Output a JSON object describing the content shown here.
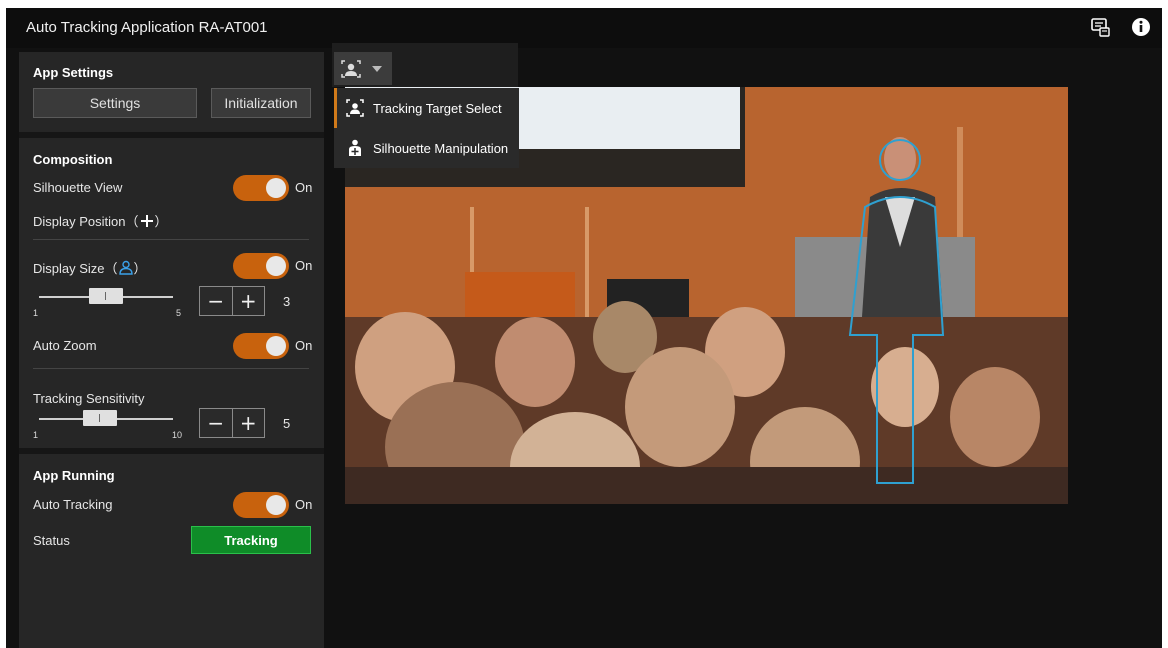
{
  "app": {
    "title": "Auto Tracking Application RA-AT001"
  },
  "header_icons": {
    "feedback": "feedback-icon",
    "info": "info-icon"
  },
  "app_settings": {
    "title": "App Settings",
    "settings_label": "Settings",
    "initialization_label": "Initialization"
  },
  "composition": {
    "title": "Composition",
    "silhouette_view": {
      "label": "Silhouette View",
      "state": "On"
    },
    "display_position": {
      "label": "Display Position（",
      "suffix": "）"
    },
    "display_size": {
      "label": "Display Size（",
      "suffix": "）",
      "state": "On",
      "min": "1",
      "max": "5",
      "value": "3",
      "level": 0.5
    },
    "auto_zoom": {
      "label": "Auto Zoom",
      "state": "On"
    },
    "tracking_sensitivity": {
      "label": "Tracking Sensitivity",
      "min": "1",
      "max": "10",
      "value": "5",
      "level": 0.44
    }
  },
  "stepper": {
    "minus": "−",
    "plus": "+"
  },
  "app_running": {
    "title": "App Running",
    "auto_tracking": {
      "label": "Auto Tracking",
      "state": "On"
    },
    "status": {
      "label": "Status",
      "value": "Tracking"
    }
  },
  "mode_menu": {
    "items": [
      {
        "label": "Tracking Target Select",
        "icon": "tracking-target-icon"
      },
      {
        "label": "Silhouette Manipulation",
        "icon": "silhouette-icon"
      }
    ]
  },
  "colors": {
    "accent": "#c8620d",
    "status_green": "#0f8c28",
    "silhouette": "#2fa0d0"
  }
}
